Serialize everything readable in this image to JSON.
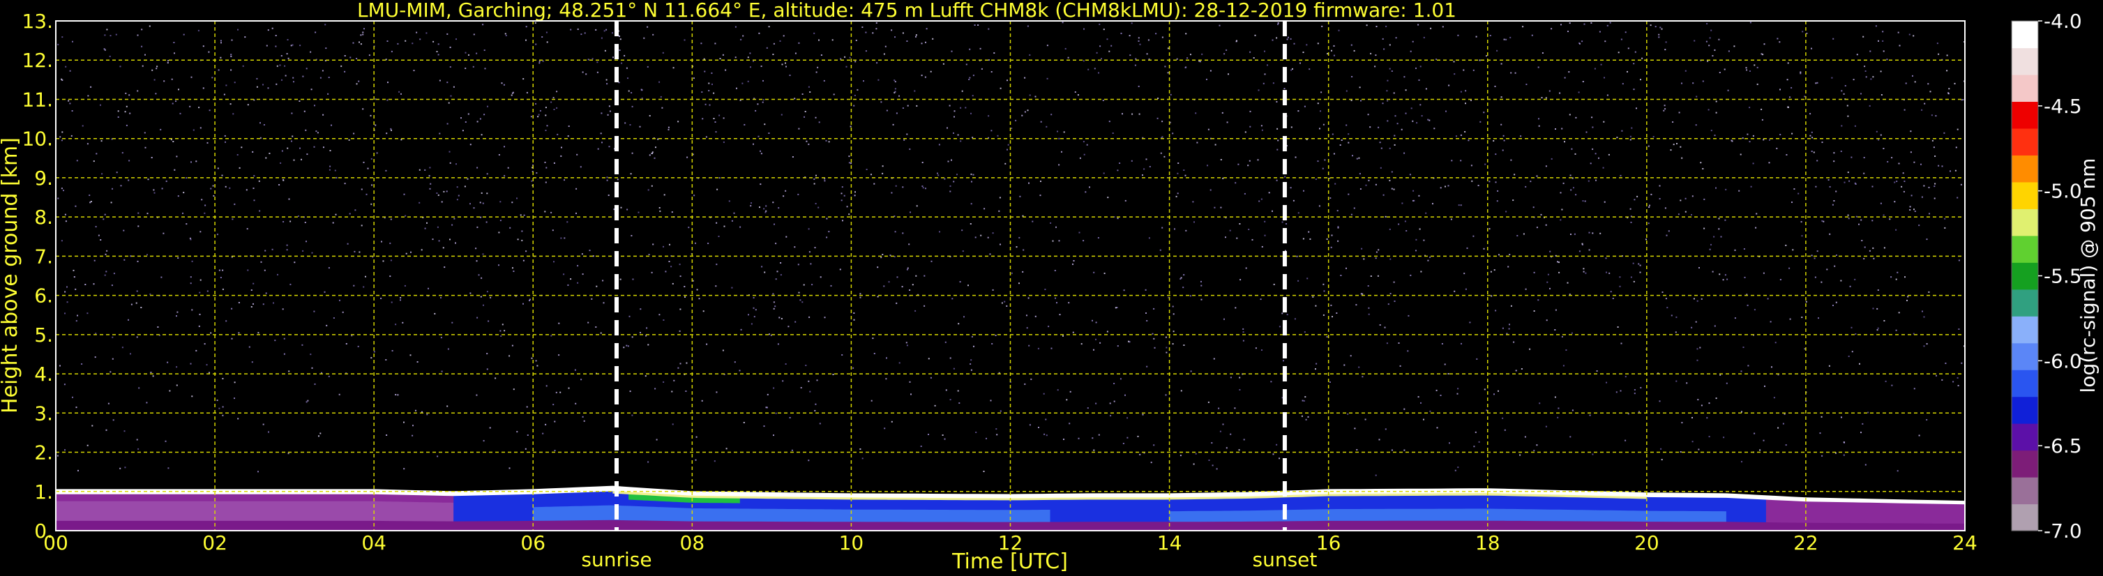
{
  "title": "LMU-MIM, Garching; 48.251° N 11.664° E, altitude: 475 m    Lufft CHM8k (CHM8kLMU): 28-12-2019    firmware: 1.01",
  "chart_data": {
    "type": "heatmap",
    "title": "LMU-MIM, Garching; 48.251° N 11.664° E, altitude: 475 m    Lufft CHM8k (CHM8kLMU): 28-12-2019    firmware: 1.01",
    "xlabel": "Time [UTC]",
    "ylabel": "Height above ground [km]",
    "colorbar_label": "log(rc-signal) @ 905 nm",
    "xlim": [
      0,
      24
    ],
    "ylim": [
      0,
      13
    ],
    "x_ticks": [
      "00",
      "02",
      "04",
      "06",
      "08",
      "10",
      "12",
      "14",
      "16",
      "18",
      "20",
      "22",
      "24"
    ],
    "y_ticks": [
      "0.",
      "1.",
      "2.",
      "3.",
      "4.",
      "5.",
      "6.",
      "7.",
      "8.",
      "9.",
      "10.",
      "11.",
      "12.",
      "13."
    ],
    "colorbar_range": [
      -7.0,
      -4.0
    ],
    "colorbar_ticks": [
      "-7.0",
      "-6.5",
      "-6.0",
      "-5.5",
      "-5.0",
      "-4.5",
      "-4.0"
    ],
    "grid": true,
    "events": [
      {
        "label": "sunrise",
        "time_utc": 7.05
      },
      {
        "label": "sunset",
        "time_utc": 15.45
      }
    ],
    "boundary_layer_top_km": [
      [
        0,
        1.0
      ],
      [
        4,
        1.0
      ],
      [
        5,
        0.95
      ],
      [
        6,
        1.0
      ],
      [
        7,
        1.08
      ],
      [
        8,
        0.95
      ],
      [
        10,
        0.9
      ],
      [
        12,
        0.88
      ],
      [
        13,
        0.9
      ],
      [
        14,
        0.9
      ],
      [
        15,
        0.93
      ],
      [
        16,
        1.0
      ],
      [
        18,
        1.02
      ],
      [
        20,
        0.92
      ],
      [
        21,
        0.9
      ],
      [
        22,
        0.8
      ],
      [
        24,
        0.72
      ]
    ]
  },
  "colors": {
    "text": "#ffff33",
    "background": "#000000",
    "colormap": [
      "#b0a0b0",
      "#9a7099",
      "#7d1d78",
      "#5c10a8",
      "#1020d8",
      "#2a55f0",
      "#5b86f7",
      "#8ab0fa",
      "#30a080",
      "#15a020",
      "#60d030",
      "#e0f070",
      "#ffd400",
      "#ff8c00",
      "#ff3010",
      "#ee0000",
      "#f4c8c8",
      "#f0e0e0",
      "#ffffff"
    ]
  }
}
